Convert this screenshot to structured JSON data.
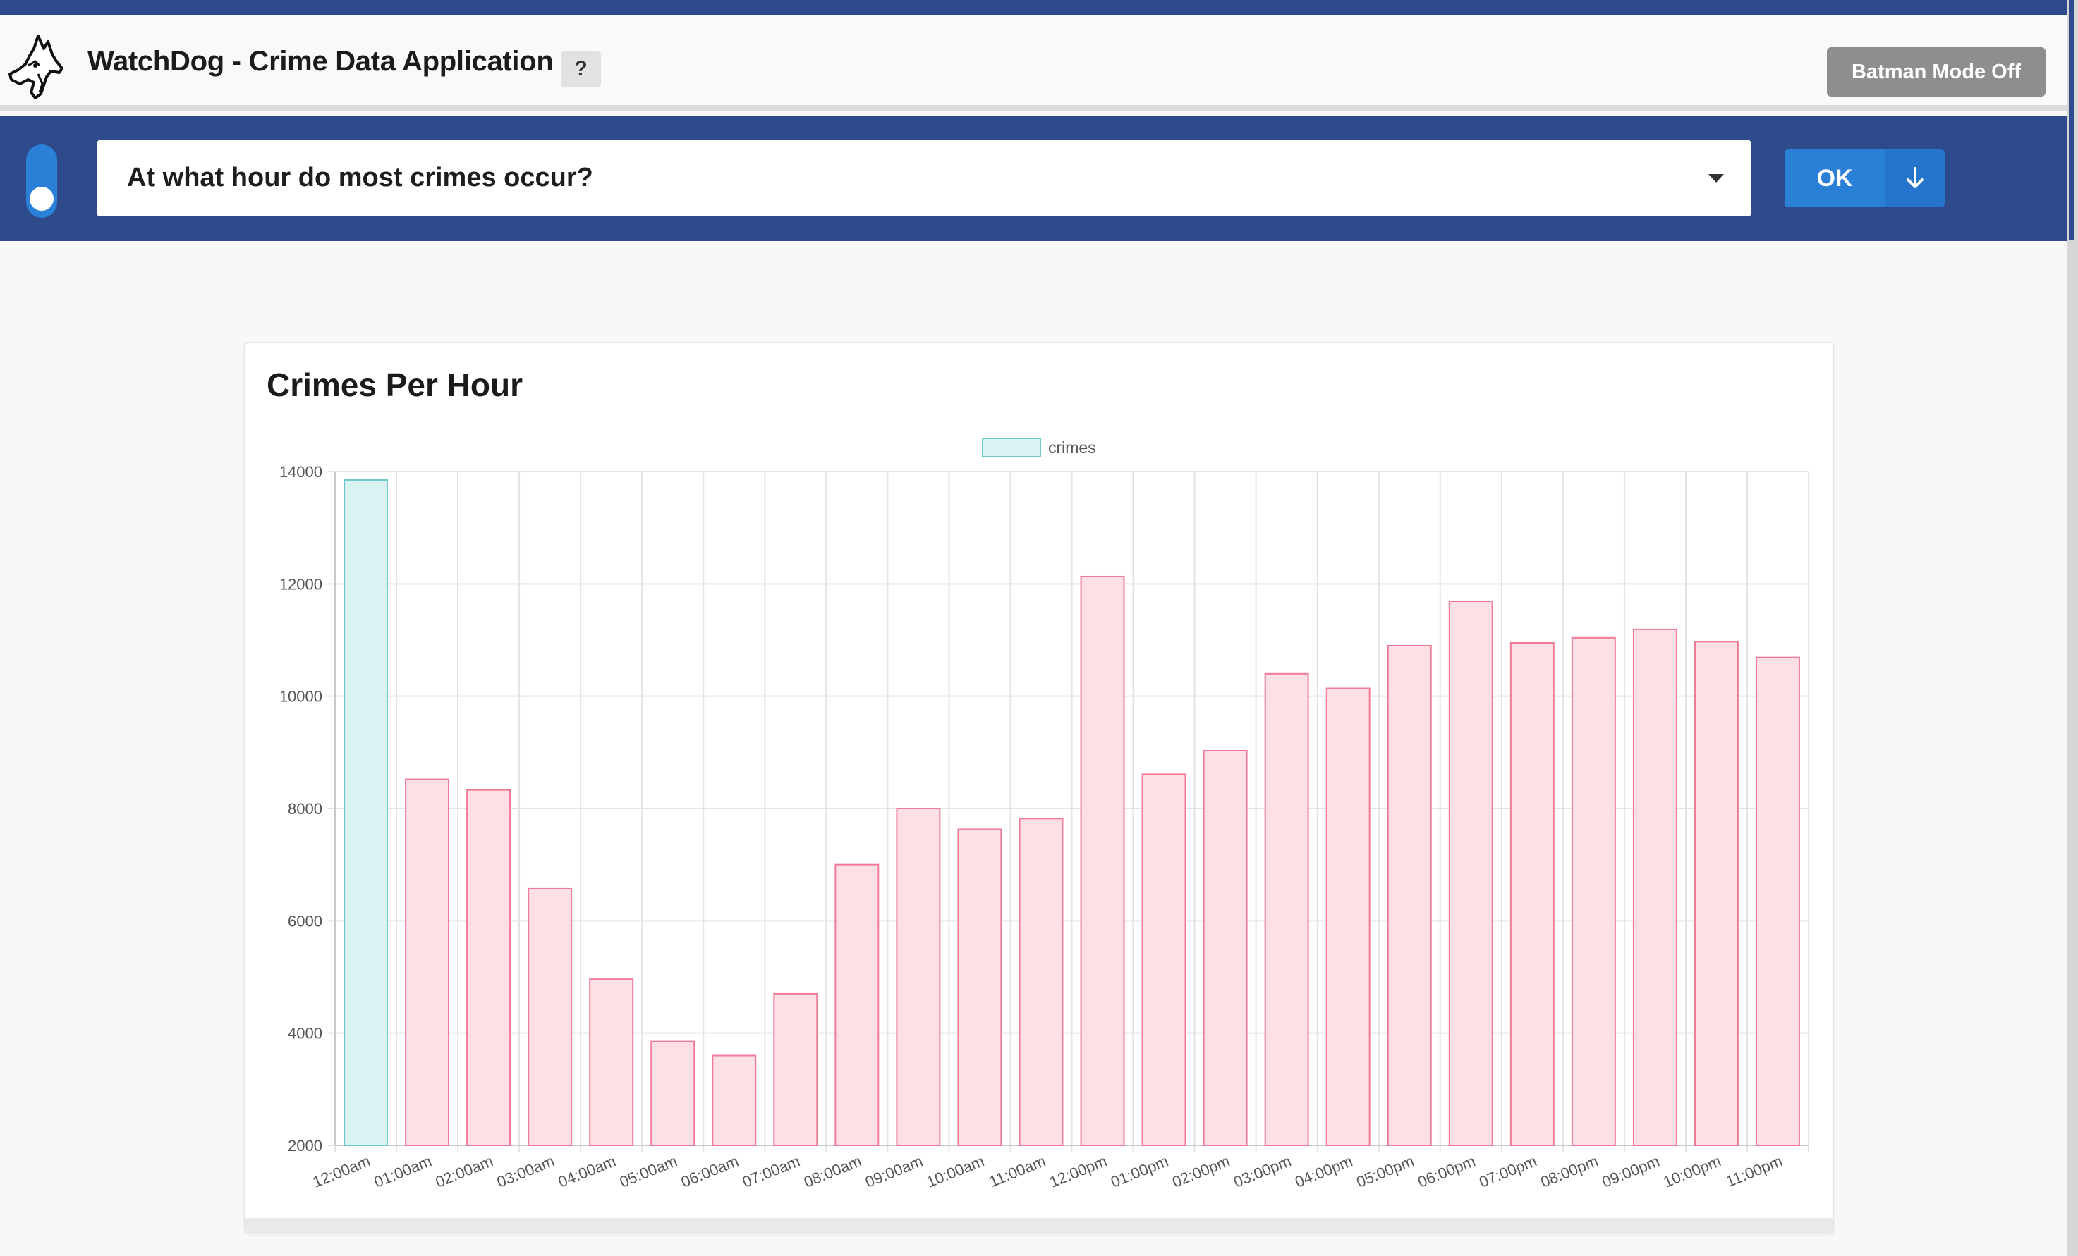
{
  "header": {
    "title": "WatchDog - Crime Data Application",
    "help_label": "?",
    "batman_label": "Batman Mode Off",
    "logo_icon": "dog-head-icon"
  },
  "query": {
    "question": "At what hour do most crimes occur?",
    "ok_label": "OK",
    "download_icon": "arrow-down-icon",
    "toggle_icon": "toggle-switch-icon"
  },
  "colors": {
    "brand_blue": "#2d4a8a",
    "accent_blue": "#2a7fd6",
    "highlight_fill": "#d9f2f2",
    "highlight_stroke": "#6cc9c9",
    "bar_fill": "#fde0e6",
    "bar_stroke": "#f07a97"
  },
  "chart_data": {
    "type": "bar",
    "title": "Crimes Per Hour",
    "xlabel": "",
    "ylabel": "",
    "ylim": [
      2000,
      14000
    ],
    "yticks": [
      2000,
      4000,
      6000,
      8000,
      10000,
      12000,
      14000
    ],
    "grid": true,
    "legend_position": "top-center",
    "categories": [
      "12:00am",
      "01:00am",
      "02:00am",
      "03:00am",
      "04:00am",
      "05:00am",
      "06:00am",
      "07:00am",
      "08:00am",
      "09:00am",
      "10:00am",
      "11:00am",
      "12:00pm",
      "01:00pm",
      "02:00pm",
      "03:00pm",
      "04:00pm",
      "05:00pm",
      "06:00pm",
      "07:00pm",
      "08:00pm",
      "09:00pm",
      "10:00pm",
      "11:00pm"
    ],
    "series": [
      {
        "name": "crimes",
        "values": [
          13850,
          8520,
          8330,
          6570,
          4960,
          3850,
          3600,
          4700,
          7000,
          8000,
          7630,
          7820,
          12130,
          8610,
          9030,
          10400,
          10140,
          10900,
          11690,
          10950,
          11040,
          11190,
          10970,
          10690
        ],
        "highlight_index": 0
      }
    ]
  }
}
